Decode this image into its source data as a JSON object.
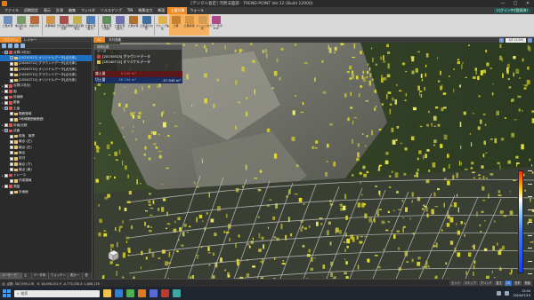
{
  "window": {
    "title": "[デジタル査定] 河原法面部 - TREND-POINT Ver.12 (Build 12000)",
    "controls": [
      "—",
      "□",
      "✕"
    ]
  },
  "ribbon": {
    "tabs": [
      "ファイル",
      "初期設定",
      "表示",
      "計測",
      "編集",
      "フィルタ",
      "ソルスデンプ",
      "TIN",
      "帳票出力",
      "断面",
      "土量計算",
      "ウォール"
    ],
    "active_tab": "土量計算",
    "user": "ログイン中(登録済)",
    "buttons": [
      {
        "label": "土量計算",
        "color": "#6b8fbf"
      },
      {
        "label": "重点別(最良)",
        "color": "#7a9a6a"
      },
      {
        "label": "内訳(印)",
        "color": "#b86a3a"
      },
      {
        "label": "点群構成",
        "color": "#d1954a"
      },
      {
        "label": "日付別点群比較",
        "color": "#a85050"
      },
      {
        "label": "前比較点群取込",
        "color": "#c0b050"
      },
      {
        "label": "土量計算(差分)",
        "color": "#4f7fb4"
      },
      {
        "label": "土量計算(法面)",
        "color": "#5f8f5f"
      },
      {
        "label": "土量計算(差分)",
        "color": "#7070b0"
      },
      {
        "label": "土量計算",
        "color": "#b07030"
      },
      {
        "label": "土量差分比較",
        "color": "#3f6f9f"
      },
      {
        "label": "グループ編集",
        "color": "#e0b04a"
      },
      {
        "label": "土量",
        "color": "#c8802a"
      },
      {
        "label": "土量情報",
        "color": "#d89440"
      },
      {
        "label": "メッシュ分析",
        "color": "#d59a55"
      },
      {
        "label": "カラー表示 PHP",
        "color": "#b04a8a"
      }
    ]
  },
  "left_panel": {
    "tabs": [
      "プロパティ",
      "レイヤー"
    ],
    "active_tab": "プロパティ",
    "tree": [
      {
        "label": "点群(3次元)",
        "depth": 0,
        "checked": true,
        "expanded": true,
        "folder": "red"
      },
      {
        "label": "[20230523] オリジナルデータ[点元体]",
        "depth": 1,
        "checked": true,
        "selected": true
      },
      {
        "label": "[20240712] グラウンドデータ[点元体]",
        "depth": 1,
        "checked": false
      },
      {
        "label": "[20240712] オリジナルデータ[点元体]",
        "depth": 1,
        "checked": false
      },
      {
        "label": "[20240712] グラウンドデータ[点元体]",
        "depth": 1,
        "checked": false
      },
      {
        "label": "[20240712] オリジナルデータ[点元体]",
        "depth": 1,
        "checked": false
      },
      {
        "label": "点群(2次元)",
        "depth": 0,
        "checked": false,
        "folder": "red"
      },
      {
        "label": "面",
        "depth": 0,
        "checked": false,
        "folder": "red"
      },
      {
        "label": "計画線",
        "depth": 0,
        "checked": false,
        "folder": "red"
      },
      {
        "label": "断面",
        "depth": 0,
        "checked": false,
        "folder": "red"
      },
      {
        "label": "土量",
        "depth": 0,
        "checked": true,
        "expanded": true,
        "folder": "red"
      },
      {
        "label": "範囲領域",
        "depth": 1,
        "checked": false
      },
      {
        "label": "2地域範囲面範囲",
        "depth": 1,
        "checked": false
      },
      {
        "label": "計画/比較",
        "depth": 0,
        "checked": false,
        "folder": "red"
      },
      {
        "label": "法面",
        "depth": 0,
        "checked": true,
        "expanded": true,
        "folder": "red"
      },
      {
        "label": "前後　境界",
        "depth": 1,
        "checked": false
      },
      {
        "label": "線点 (左)",
        "depth": 1,
        "checked": false
      },
      {
        "label": "線点 (右)",
        "depth": 1,
        "checked": false
      },
      {
        "label": "線点",
        "depth": 1,
        "checked": false
      },
      {
        "label": "吹付",
        "depth": 1,
        "checked": false
      },
      {
        "label": "線点 (下)",
        "depth": 1,
        "checked": false
      },
      {
        "label": "線点 (奥)",
        "depth": 1,
        "checked": false
      },
      {
        "label": "トレース",
        "depth": 0,
        "checked": false,
        "folder": "red"
      },
      {
        "label": "作成領域",
        "depth": 1,
        "checked": false
      },
      {
        "label": "測量",
        "depth": 0,
        "checked": false,
        "folder": "red"
      },
      {
        "label": "計画面",
        "depth": 1,
        "checked": false
      }
    ],
    "bottom_tabs": [
      "ユーザーデータ",
      "土量",
      "データ特性",
      "ウォッチング",
      "表示一覧",
      "表示"
    ]
  },
  "viewport": {
    "tabs": [
      "3D",
      "平行投影"
    ],
    "active_tab": "3D",
    "zoom": "1/2 (1:24)",
    "volume_panel": {
      "header": "体積比較",
      "subheader": "データ",
      "items": [
        {
          "label": "[20230523] グラウンドデータ",
          "color": "#d04040"
        },
        {
          "label": "[20240712] オリジナルデータ",
          "color": "#e0c040"
        }
      ]
    },
    "volume_rows": [
      {
        "key": "盛土量",
        "value": "0.345 m³",
        "total": "",
        "color": "#d33",
        "bg": "#7a1a1a"
      },
      {
        "key": "切土量",
        "value": "38.294 m³",
        "total": "-37.949 m³",
        "color": "#3b8cff",
        "bg": "#1a2f60"
      }
    ]
  },
  "status_bar": {
    "text": "点: 点数: 387,594,178　X: 18,496.201  Y: -4,773,038  Z: 1,608,178",
    "buttons": [
      "ヒント",
      "スナップ",
      "グリッド",
      "直交",
      "3D",
      "選択",
      "断面"
    ]
  },
  "taskbar": {
    "search_placeholder": "検索",
    "time": "13:04",
    "date": "2024/07/19"
  }
}
